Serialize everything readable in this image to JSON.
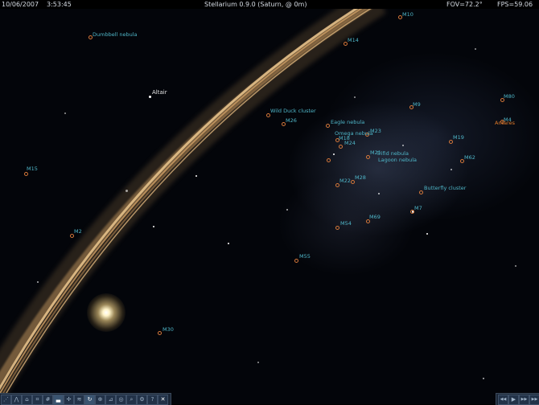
{
  "topbar": {
    "date": "10/06/2007",
    "time": "3:53:45",
    "app_title": "Stellarium 0.9.0 (Saturn, @ 0m)",
    "fov": "FOV=72.2°",
    "fps": "FPS=59.06"
  },
  "objects": {
    "m10": "M10",
    "dumbbell": "Dumbbell nebula",
    "m14": "M14",
    "altair": "Altair",
    "m80": "M80",
    "m4": "M4",
    "antares": "Antares",
    "m9": "M9",
    "wild_duck": "Wild Duck cluster",
    "m26": "M26",
    "eagle": "Eagle nebula",
    "omega": "Omega nebula",
    "m23": "M23",
    "m18": "M18",
    "m24": "M24",
    "m19": "M19",
    "m21": "M21",
    "trifid": "Trifid nebula",
    "lagoon": "Lagoon nebula",
    "m62": "M62",
    "m15": "M15",
    "m28": "M28",
    "m22": "M22",
    "butterfly": "Butterfly cluster",
    "m7": "M7",
    "m69": "M69",
    "m54": "M54",
    "m2": "M2",
    "m55": "M55",
    "m30": "M30"
  },
  "toolbar": {
    "buttons": [
      "constellation-lines",
      "constellation-names",
      "constellation-art",
      "azimuthal-grid",
      "equatorial-grid",
      "ground",
      "cardinal-points",
      "atmosphere",
      "nebulas",
      "planets",
      "equatorial-mount",
      "center-selected",
      "night-mode",
      "search",
      "configuration",
      "help",
      "quit"
    ],
    "quit_symbol": "✕",
    "help_symbol": "?"
  },
  "timebar": {
    "rewind": "◀◀",
    "play": "▶",
    "forward": "▶▶"
  },
  "colors": {
    "label_cyan": "#4fb6c8",
    "marker_orange": "#d6783a",
    "antares_orange": "#e07a2a",
    "ring_tan": "#c89a63"
  }
}
